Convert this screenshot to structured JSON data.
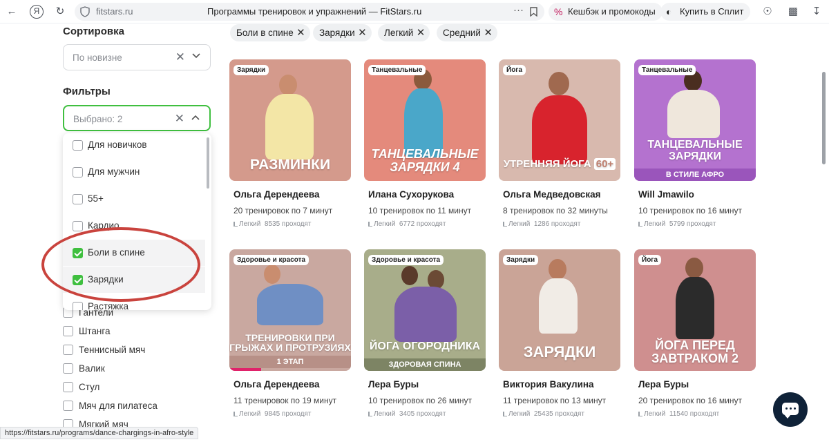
{
  "browser": {
    "domain": "fitstars.ru",
    "tab_title": "Программы тренировок и упражнений — FitStars.ru",
    "yandex_logo": "Я",
    "pill_cashback": "Кешбэк и промокоды",
    "pill_split": "Купить в Сплит",
    "status_url": "https://fitstars.ru/programs/dance-chargings-in-afro-style"
  },
  "sidebar": {
    "sort_title": "Сортировка",
    "sort_value": "По новизне",
    "filters_title": "Фильтры",
    "filters_value": "Выбрано: 2",
    "dropdown_items": [
      {
        "label": "Для новичков",
        "checked": false
      },
      {
        "label": "Для мужчин",
        "checked": false
      },
      {
        "label": "55+",
        "checked": false
      },
      {
        "label": "Кардио",
        "checked": false
      },
      {
        "label": "Боли в спине",
        "checked": true
      },
      {
        "label": "Зарядки",
        "checked": true
      },
      {
        "label": "Растяжка",
        "checked": false
      }
    ],
    "equipment_items": [
      "Гантели",
      "Штанга",
      "Теннисный мяч",
      "Валик",
      "Стул",
      "Мяч для пилатеса",
      "Мягкий мяч"
    ]
  },
  "chips": [
    "Боли в спине",
    "Зарядки",
    "Легкий",
    "Средний"
  ],
  "cards": [
    {
      "badge": "Зарядки",
      "overlay": "РАЗМИНКИ",
      "sub_overlay": "",
      "name": "Ольга Дерендеева",
      "workouts": "20 тренировок по 7 минут",
      "level": "Легкий",
      "count": "8535 проходят",
      "bg": "#d49a8c"
    },
    {
      "badge": "Танцевальные",
      "overlay": "ТАНЦЕВАЛЬНЫЕ ЗАРЯДКИ 4",
      "sub_overlay": "",
      "name": "Илана Сухорукова",
      "workouts": "10 тренировок по 11 минут",
      "level": "Легкий",
      "count": "6772 проходят",
      "bg": "#e48a7c"
    },
    {
      "badge": "Йога",
      "overlay": "УТРЕННЯЯ ЙОГА",
      "sub_overlay": "60+",
      "name": "Ольга Медведовская",
      "workouts": "8 тренировок по 32 минуты",
      "level": "Легкий",
      "count": "1286 проходят",
      "bg": "#d8b9ae"
    },
    {
      "badge": "Танцевальные",
      "overlay": "ТАНЦЕВАЛЬНЫЕ ЗАРЯДКИ",
      "sub_overlay": "В СТИЛЕ АФРО",
      "name": "Will Jmawilo",
      "workouts": "10 тренировок по 16 минут",
      "level": "Легкий",
      "count": "5799 проходят",
      "bg": "#b472cf"
    },
    {
      "badge": "Здоровье и красота",
      "overlay": "ТРЕНИРОВКИ ПРИ ГРЫЖАХ И ПРОТРУЗИЯХ",
      "sub_overlay": "1 ЭТАП",
      "name": "Ольга Дерендеева",
      "workouts": "11 тренировок по 19 минут",
      "level": "Легкий",
      "count": "9845 проходят",
      "bg": "#c9a8a0"
    },
    {
      "badge": "Здоровье и красота",
      "overlay": "ЙОГА ОГОРОДНИКА",
      "sub_overlay": "ЗДОРОВАЯ СПИНА",
      "name": "Лера Буры",
      "workouts": "10 тренировок по 26 минут",
      "level": "Легкий",
      "count": "3405 проходят",
      "bg": "#a8ad8a"
    },
    {
      "badge": "Зарядки",
      "overlay": "ЗАРЯДКИ",
      "sub_overlay": "",
      "name": "Виктория Вакулина",
      "workouts": "11 тренировок по 13 минут",
      "level": "Легкий",
      "count": "25435 проходят",
      "bg": "#caa497"
    },
    {
      "badge": "Йога",
      "overlay": "ЙОГА ПЕРЕД ЗАВТРАКОМ 2",
      "sub_overlay": "",
      "name": "Лера Буры",
      "workouts": "20 тренировок по 16 минут",
      "level": "Легкий",
      "count": "11540 проходят",
      "bg": "#cf8f8f"
    }
  ]
}
